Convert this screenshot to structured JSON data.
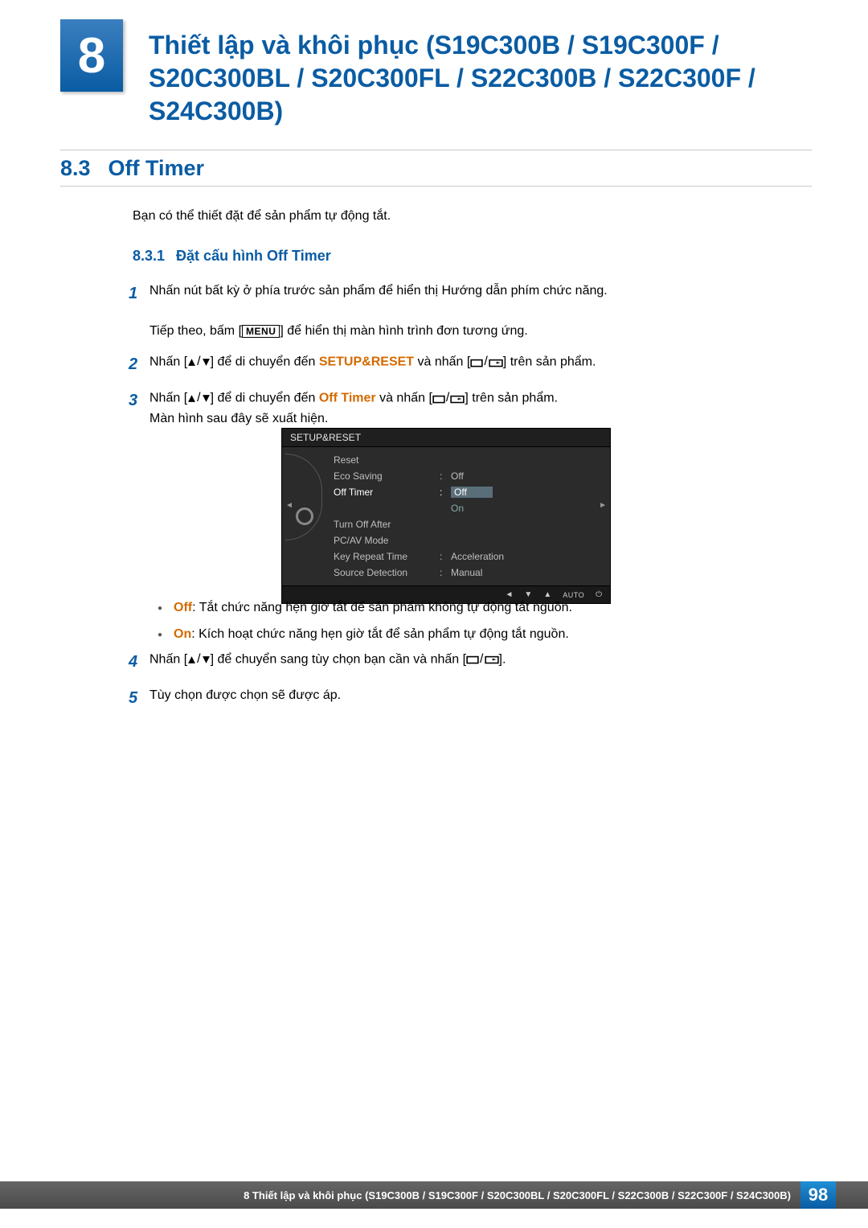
{
  "chapter": {
    "number": "8",
    "title": "Thiết lập và khôi phục (S19C300B / S19C300F / S20C300BL / S20C300FL / S22C300B / S22C300F / S24C300B)"
  },
  "section": {
    "number": "8.3",
    "title": "Off Timer",
    "intro": "Bạn có thể thiết đặt để sản phẩm tự động tắt."
  },
  "subsection": {
    "number": "8.3.1",
    "title": "Đặt cấu hình Off Timer"
  },
  "steps": {
    "s1a": "Nhấn nút bất kỳ ở phía trước sản phẩm để hiển thị Hướng dẫn phím chức năng.",
    "s1b_pre": "Tiếp theo, bấm [",
    "s1b_menu": "MENU",
    "s1b_post": "] để hiển thị màn hình trình đơn tương ứng.",
    "s2_pre": "Nhấn [",
    "s2_mid": "] để di chuyển đến ",
    "s2_target": "SETUP&RESET",
    "s2_post1": " và nhấn [",
    "s2_post2": "] trên sản phẩm.",
    "s3_pre": "Nhấn [",
    "s3_mid": "] để di chuyển đến ",
    "s3_target": "Off Timer",
    "s3_post1": " và nhấn [",
    "s3_post2": "] trên sản phẩm.",
    "s3_line2": "Màn hình sau đây sẽ xuất hiện.",
    "s4_pre": "Nhấn [",
    "s4_mid": "] để chuyển sang tùy chọn bạn cần và nhấn [",
    "s4_post": "].",
    "s5": "Tùy chọn được chọn sẽ được áp."
  },
  "osd": {
    "title": "SETUP&RESET",
    "rows": [
      {
        "label": "Reset",
        "val": ""
      },
      {
        "label": "Eco Saving",
        "val": "Off"
      },
      {
        "label": "Off Timer",
        "val": "Off",
        "hl": true,
        "selOff": true
      },
      {
        "label": "",
        "val": "On",
        "selOn": true
      },
      {
        "label": "Turn Off After",
        "val": ""
      },
      {
        "label": "PC/AV Mode",
        "val": ""
      },
      {
        "label": "Key Repeat Time",
        "val": "Acceleration"
      },
      {
        "label": "Source Detection",
        "val": "Manual"
      }
    ],
    "footer_auto": "AUTO"
  },
  "bullets": {
    "off_kw": "Off",
    "off_txt": ": Tắt chức năng hẹn giờ tắt để sản phẩm không tự động tắt nguồn.",
    "on_kw": "On",
    "on_txt": ": Kích hoạt chức năng hẹn giờ tắt để sản phẩm tự động tắt nguồn."
  },
  "footer": {
    "text": "8 Thiết lập và khôi phục (S19C300B / S19C300F / S20C300BL / S20C300FL / S22C300B / S22C300F / S24C300B)",
    "page": "98"
  }
}
